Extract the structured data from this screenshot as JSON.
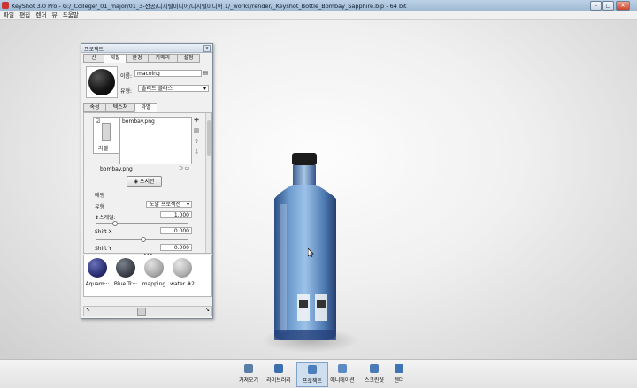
{
  "window": {
    "title": "KeyShot 3.0 Pro - G:/_College/_01_major/01_3-전공/디지털미디어/디지털미디어 1/_works/render/_Keyshot_Bottle_Bombay_Sapphire.bip - 64 bit",
    "buttons": [
      "–",
      "□",
      "✕"
    ]
  },
  "menu": [
    "파일",
    "편집",
    "렌더",
    "뷰",
    "도움말"
  ],
  "panel": {
    "title": "프로젝트",
    "tabs": [
      "신",
      "재질",
      "환경",
      "카메라",
      "설정"
    ],
    "active_tab": "재질",
    "material": {
      "name_label": "이름:",
      "name_value": "macoing",
      "type_label": "유형:",
      "type_value": "솔리드 글라스"
    },
    "subtabs": [
      "속성",
      "텍스쳐",
      "라벨"
    ],
    "active_subtab": "라벨",
    "labels": {
      "list_item": "bombay.png",
      "box_label": "라벨",
      "file": "bombay.png",
      "position_button": "포지션",
      "mapping_header": "매핑",
      "type_label": "유형",
      "type_value": "노말 프로젝션",
      "scale_label": "↕스케일:",
      "scale_value": "1.000",
      "shiftx_label": "Shift X",
      "shiftx_value": "0.000",
      "shifty_label": "Shift Y",
      "shifty_value": "0.000"
    },
    "swatches": [
      {
        "label": "Aquam···",
        "color": "#2a2f73"
      },
      {
        "label": "Blue Tr···",
        "color": "#3b4048"
      },
      {
        "label": "mapping",
        "color": "#a8a8a8"
      },
      {
        "label": "water #2",
        "color": "#b0b0b0"
      }
    ]
  },
  "toolbar": [
    {
      "label": "가져오기",
      "icon": "import-icon",
      "color": "#5a7ea8"
    },
    {
      "label": "라이브러리",
      "icon": "library-icon",
      "color": "#3b6fb0"
    },
    {
      "label": "프로젝트",
      "icon": "project-icon",
      "color": "#4d7fbf"
    },
    {
      "label": "애니메이션",
      "icon": "animation-icon",
      "color": "#5c8ac4"
    },
    {
      "label": "스크린샷",
      "icon": "screenshot-icon",
      "color": "#4b7bb7"
    },
    {
      "label": "렌더",
      "icon": "render-icon",
      "color": "#3f74b4"
    }
  ]
}
